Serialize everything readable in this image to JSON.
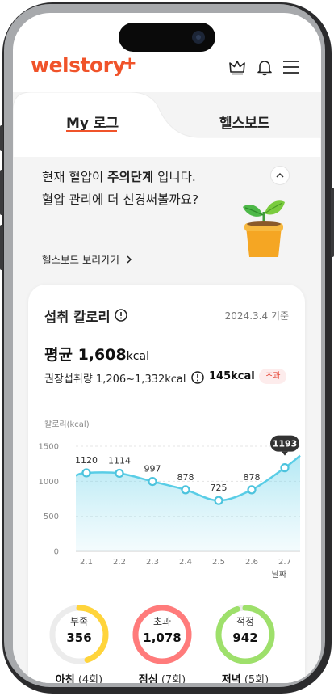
{
  "header": {
    "logo_text": "welstory",
    "logo_plus": "+",
    "brand_color": "#f0532a",
    "icons": [
      "crown-icon",
      "bell-icon",
      "menu-icon"
    ]
  },
  "tabs": [
    {
      "label": "My 로그",
      "active": true
    },
    {
      "label": "헬스보드",
      "active": false
    }
  ],
  "status": {
    "line1_prefix": "현재 혈압이 ",
    "line1_emphasis": "주의단계",
    "line1_suffix": " 입니다.",
    "line2": "혈압 관리에 더 신경써볼까요?",
    "link_label": "헬스보드 보러가기",
    "illustration": "plant-pot"
  },
  "calorie_card": {
    "title": "섭취 칼로리",
    "date": "2024.3.4 기준",
    "average_label": "평균 ",
    "average_value": "1,608",
    "average_unit": "kcal",
    "recommended_text": "권장섭취량 1,206~1,332kcal",
    "excess_value": "145kcal",
    "excess_badge": "초과"
  },
  "chart_data": {
    "type": "area",
    "ylabel": "칼로리(kcal)",
    "xlabel": "날짜",
    "ylim": [
      0,
      1500
    ],
    "yticks": [
      "1500",
      "1000",
      "500",
      "0"
    ],
    "categories": [
      "2.1",
      "2.2",
      "2.3",
      "2.4",
      "2.5",
      "2.6",
      "2.7"
    ],
    "values": [
      1120,
      1114,
      997,
      878,
      725,
      878,
      1193
    ],
    "value_labels": [
      "1120",
      "1114",
      "997",
      "878",
      "725",
      "878",
      "1193"
    ],
    "highlighted_index": 6,
    "line_color": "#59cde6",
    "fill_color": "#dff5fb"
  },
  "meals": [
    {
      "name": "아침",
      "count": "(4회)",
      "status": "부족",
      "value": "356",
      "ring_color": "#ffd43b",
      "ratio": 0.45
    },
    {
      "name": "점심",
      "count": "(7회)",
      "status": "초과",
      "value": "1,078",
      "ring_color": "#ff7b7b",
      "ratio": 1.0
    },
    {
      "name": "저녁",
      "count": "(5회)",
      "status": "적정",
      "value": "942",
      "ring_color": "#9ee06b",
      "ratio": 0.95
    }
  ]
}
